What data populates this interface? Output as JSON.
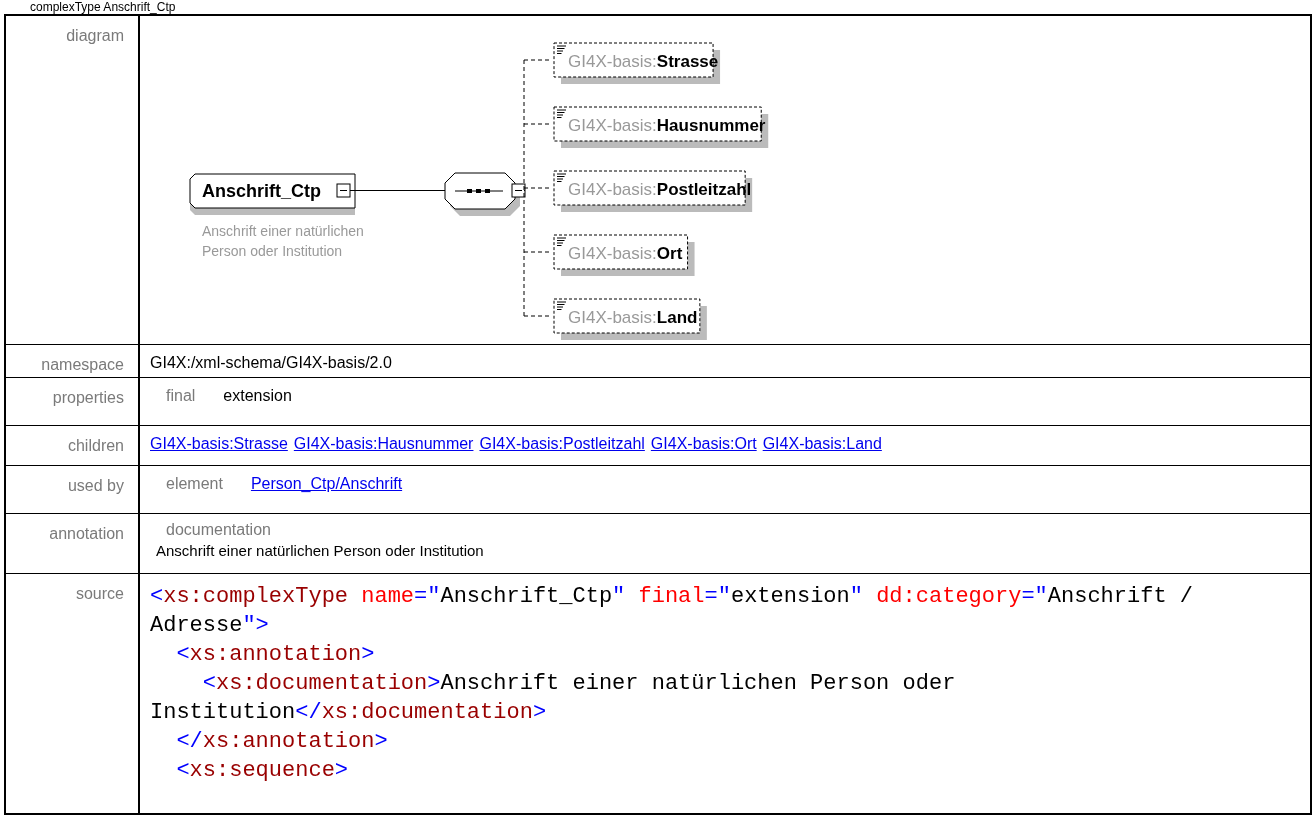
{
  "title": "complexType Anschrift_Ctp",
  "diagram": {
    "label": "diagram",
    "root": {
      "name": "Anschrift_Ctp",
      "documentation": "Anschrift einer natürlichen Person oder Institution"
    },
    "elements": [
      {
        "prefix": "GI4X-basis:",
        "name": "Strasse"
      },
      {
        "prefix": "GI4X-basis:",
        "name": "Hausnummer"
      },
      {
        "prefix": "GI4X-basis:",
        "name": "Postleitzahl"
      },
      {
        "prefix": "GI4X-basis:",
        "name": "Ort"
      },
      {
        "prefix": "GI4X-basis:",
        "name": "Land"
      }
    ]
  },
  "namespace": {
    "label": "namespace",
    "value": "GI4X:/xml-schema/GI4X-basis/2.0"
  },
  "properties": {
    "label": "properties",
    "key": "final",
    "value": "extension"
  },
  "children": {
    "label": "children",
    "links": [
      "GI4X-basis:Strasse",
      "GI4X-basis:Hausnummer",
      "GI4X-basis:Postleitzahl",
      "GI4X-basis:Ort",
      "GI4X-basis:Land"
    ]
  },
  "used_by": {
    "label": "used by",
    "kind": "element",
    "link": "Person_Ctp/Anschrift"
  },
  "annotation": {
    "label": "annotation",
    "heading": "documentation",
    "text": "Anschrift einer natürlichen Person oder Institution"
  },
  "source": {
    "label": "source",
    "lines": [
      {
        "tokens": [
          {
            "kind": "bracket",
            "text": "<"
          },
          {
            "kind": "tag",
            "text": "xs:complexType"
          },
          {
            "kind": "attr",
            "text": "name"
          },
          {
            "kind": "bracket",
            "text": "=\""
          },
          {
            "kind": "text",
            "text": "Anschrift_Ctp"
          },
          {
            "kind": "bracket",
            "text": "\""
          },
          {
            "kind": "attr",
            "text": "final"
          },
          {
            "kind": "bracket",
            "text": "=\""
          },
          {
            "kind": "text",
            "text": "extension"
          },
          {
            "kind": "bracket",
            "text": "\""
          },
          {
            "kind": "attr",
            "text": "dd:category"
          },
          {
            "kind": "bracket",
            "text": "=\""
          },
          {
            "kind": "text",
            "text": "Anschrift / Adresse"
          },
          {
            "kind": "bracket",
            "text": "\">"
          }
        ],
        "children": [
          {
            "tokens": [
              {
                "kind": "bracket",
                "text": "<"
              },
              {
                "kind": "tag",
                "text": "xs:annotation"
              },
              {
                "kind": "bracket",
                "text": ">"
              }
            ],
            "children": [
              {
                "tokens": [
                  {
                    "kind": "bracket",
                    "text": "<"
                  },
                  {
                    "kind": "tag",
                    "text": "xs:documentation"
                  },
                  {
                    "kind": "bracket",
                    "text": ">"
                  },
                  {
                    "kind": "text",
                    "text": "Anschrift einer natürlichen Person oder Institution"
                  },
                  {
                    "kind": "bracket",
                    "text": "</"
                  },
                  {
                    "kind": "tag",
                    "text": "xs:documentation"
                  },
                  {
                    "kind": "bracket",
                    "text": ">"
                  }
                ]
              }
            ]
          },
          {
            "tokens": [
              {
                "kind": "bracket",
                "text": "</"
              },
              {
                "kind": "tag",
                "text": "xs:annotation"
              },
              {
                "kind": "bracket",
                "text": ">"
              }
            ]
          },
          {
            "tokens": [
              {
                "kind": "bracket",
                "text": "<"
              },
              {
                "kind": "tag",
                "text": "xs:sequence"
              },
              {
                "kind": "bracket",
                "text": ">"
              }
            ]
          }
        ]
      }
    ]
  }
}
